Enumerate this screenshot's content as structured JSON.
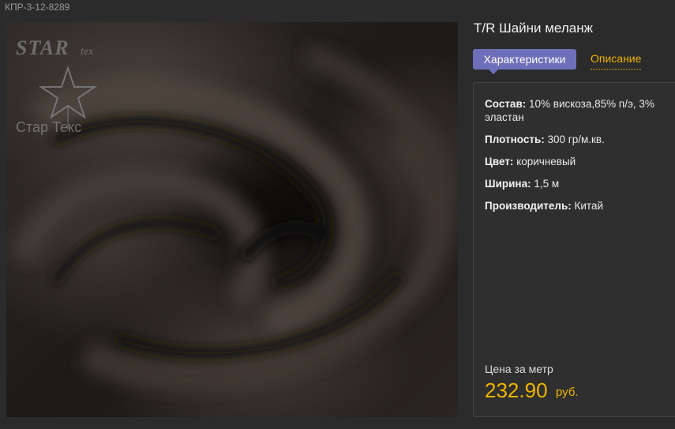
{
  "product": {
    "sku": "КПР-3-12-8289",
    "title": "T/R Шайни меланж"
  },
  "logo": {
    "star_text": "STAR",
    "tex_text": "tex",
    "sub_text": "Стар Текс"
  },
  "tabs": [
    {
      "label": "Характеристики",
      "active": true
    },
    {
      "label": "Описание",
      "active": false
    }
  ],
  "specs": [
    {
      "label": "Состав:",
      "value": "10% вискоза,85% п/э, 3% эластан"
    },
    {
      "label": "Плотность:",
      "value": "300 гр/м.кв."
    },
    {
      "label": "Цвет:",
      "value": "коричневый"
    },
    {
      "label": "Ширина:",
      "value": "1,5 м"
    },
    {
      "label": "Производитель:",
      "value": "Китай"
    }
  ],
  "price": {
    "label": "Цена за метр",
    "value": "232.90",
    "currency": "руб."
  },
  "colors": {
    "background": "#2b2b2b",
    "accent_tab": "#6e6fb9",
    "price": "#f0b400"
  }
}
